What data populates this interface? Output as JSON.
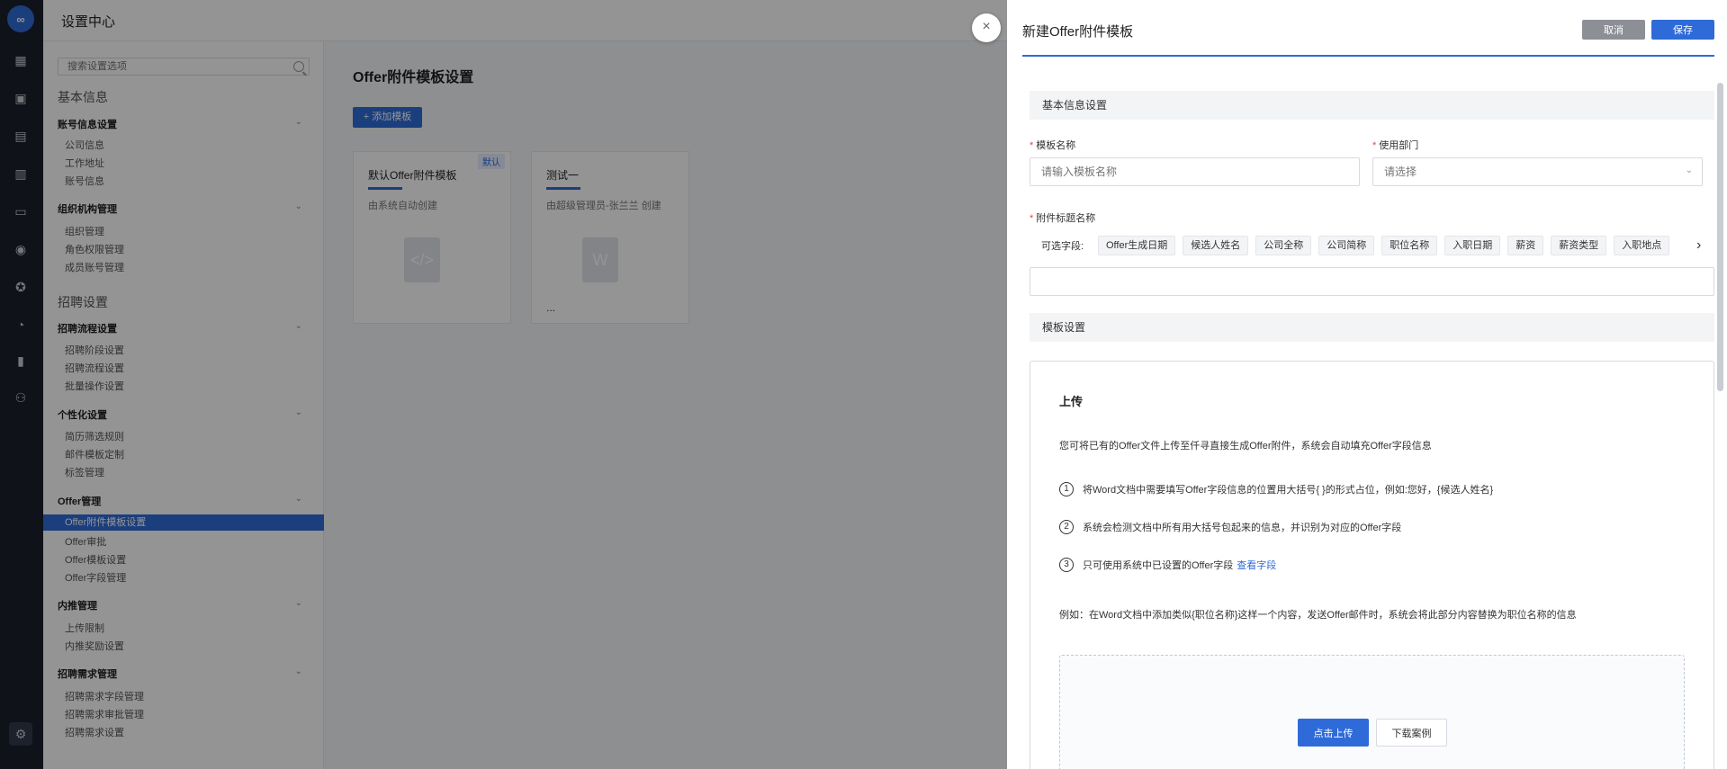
{
  "app": {
    "logo_text": "∞",
    "header_title": "设置中心"
  },
  "rail": {
    "icons": [
      "dashboard-icon",
      "briefcase-icon",
      "resume-icon",
      "table-icon",
      "id-card-icon",
      "chat-icon",
      "star-icon",
      "pie-icon",
      "bar-chart-icon",
      "people-icon",
      "settings-icon"
    ]
  },
  "sidebar": {
    "search_placeholder": "搜索设置选项",
    "sections": [
      {
        "title": "基本信息"
      },
      {
        "title": "招聘设置"
      }
    ],
    "groups": {
      "account": {
        "title": "账号信息设置",
        "items": [
          "公司信息",
          "工作地址",
          "账号信息"
        ]
      },
      "org": {
        "title": "组织机构管理",
        "items": [
          "组织管理",
          "角色权限管理",
          "成员账号管理"
        ]
      },
      "flow": {
        "title": "招聘流程设置",
        "items": [
          "招聘阶段设置",
          "招聘流程设置",
          "批量操作设置"
        ]
      },
      "personal": {
        "title": "个性化设置",
        "items": [
          "简历筛选规则",
          "邮件模板定制",
          "标签管理"
        ]
      },
      "offer": {
        "title": "Offer管理",
        "items": [
          "Offer附件模板设置",
          "Offer审批",
          "Offer模板设置",
          "Offer字段管理"
        ],
        "active_index": 0
      },
      "referral": {
        "title": "内推管理",
        "items": [
          "上传限制",
          "内推奖励设置"
        ]
      },
      "demand": {
        "title": "招聘需求管理",
        "items": [
          "招聘需求字段管理",
          "招聘需求审批管理",
          "招聘需求设置"
        ]
      }
    }
  },
  "main": {
    "title": "Offer附件模板设置",
    "add_button": "+ 添加模板",
    "cards": [
      {
        "title": "默认Offer附件模板",
        "sub": "由系统自动创建",
        "badge": "默认"
      },
      {
        "title": "测试一",
        "sub": "由超级管理员-张兰兰 创建",
        "more": "..."
      }
    ]
  },
  "drawer": {
    "close_symbol": "×",
    "title": "新建Offer附件模板",
    "cancel": "取消",
    "save": "保存",
    "basic_section": "基本信息设置",
    "template_name_label": "模板名称",
    "template_name_placeholder": "请输入模板名称",
    "dept_label": "使用部门",
    "dept_placeholder": "请选择",
    "attach_title_label": "附件标题名称",
    "optional_fields_label": "可选字段:",
    "chips": [
      "Offer生成日期",
      "候选人姓名",
      "公司全称",
      "公司简称",
      "职位名称",
      "入职日期",
      "薪资",
      "薪资类型",
      "入职地点"
    ],
    "template_section": "模板设置",
    "upload": {
      "title": "上传",
      "desc": "您可将已有的Offer文件上传至仟寻直接生成Offer附件，系统会自动填充Offer字段信息",
      "steps": [
        {
          "num": "1",
          "text": "将Word文档中需要填写Offer字段信息的位置用大括号{ }的形式占位，例如:您好，{候选人姓名}"
        },
        {
          "num": "2",
          "text": "系统会检测文档中所有用大括号包起来的信息，并识别为对应的Offer字段"
        },
        {
          "num": "3",
          "text": "只可使用系统中已设置的Offer字段",
          "link": "查看字段"
        }
      ],
      "example": "例如：在Word文档中添加类似{职位名称}这样一个内容，发送Offer邮件时，系统会将此部分内容替换为职位名称的信息",
      "upload_button": "点击上传",
      "download_button": "下载案例"
    }
  },
  "colors": {
    "primary": "#2f6bd8",
    "rail": "#1a1f2b",
    "required": "#e54545"
  }
}
